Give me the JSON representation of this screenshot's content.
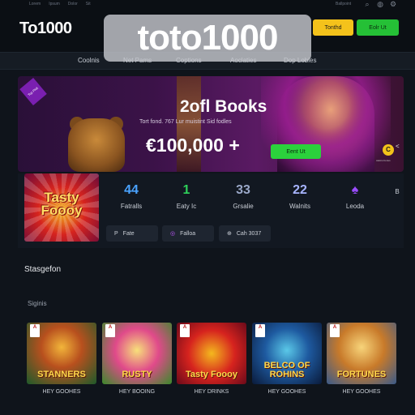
{
  "header": {
    "top_links": [
      "Lorem",
      "Ipsum",
      "Dolor",
      "Sit"
    ],
    "brand": "To1000",
    "watermark": "toto1000",
    "account_text": "Ballpoint",
    "login_label": "Tonthd",
    "join_label": "Eolr Ut"
  },
  "nav": {
    "items": [
      "Coolnis",
      "Net Pams",
      "Coptions",
      "Aoclaties",
      "Dop Lobles"
    ]
  },
  "hero": {
    "badge": "Top Pick",
    "title": "2ofl Books",
    "subtitle": "Tort fond. 767 Lur muistint Sid fodles",
    "amount": "€100,000 +",
    "cta_label": "Eent Ut",
    "coin_letter": "C",
    "brand_text": "casino bonus",
    "arrow": "<"
  },
  "featured_game": {
    "title": "Tasty Foooy"
  },
  "stats": [
    {
      "value": "44",
      "label": "Fatralls",
      "color": "#4aa3ff"
    },
    {
      "value": "1",
      "label": "Eaty Ic",
      "color": "#2ed15a"
    },
    {
      "value": "33",
      "label": "Grsalie",
      "color": "#9aa8c8"
    },
    {
      "value": "22",
      "label": "Walnits",
      "color": "#a7b4ff"
    },
    {
      "value": "♠",
      "label": "Leoda",
      "color": "#9b4dff"
    },
    {
      "value": "",
      "label": "B",
      "color": "#cccccc"
    }
  ],
  "pills": [
    {
      "icon": "P",
      "label": "Fate"
    },
    {
      "icon": "◎",
      "label": "Falloa"
    },
    {
      "icon": "⊕",
      "label": "Cah 3037"
    }
  ],
  "sections": {
    "first": "Stasgefon",
    "second": "Siginis"
  },
  "games": [
    {
      "title": "STANNERS",
      "label": "HEY GOOHES",
      "card": "A"
    },
    {
      "title": "RUSTY",
      "label": "HEY BOOING",
      "card": "A"
    },
    {
      "title": "Tasty Foooy",
      "label": "HEY DRINKS",
      "card": "A"
    },
    {
      "title": "BELCO OF ROHINS",
      "label": "HEY GOOHES",
      "card": "A"
    },
    {
      "title": "FORTUNES",
      "label": "HEY GOOHES",
      "card": "A"
    }
  ],
  "colors": {
    "accent_yellow": "#f4c21b",
    "accent_green": "#25c036",
    "background": "#0f141b"
  }
}
